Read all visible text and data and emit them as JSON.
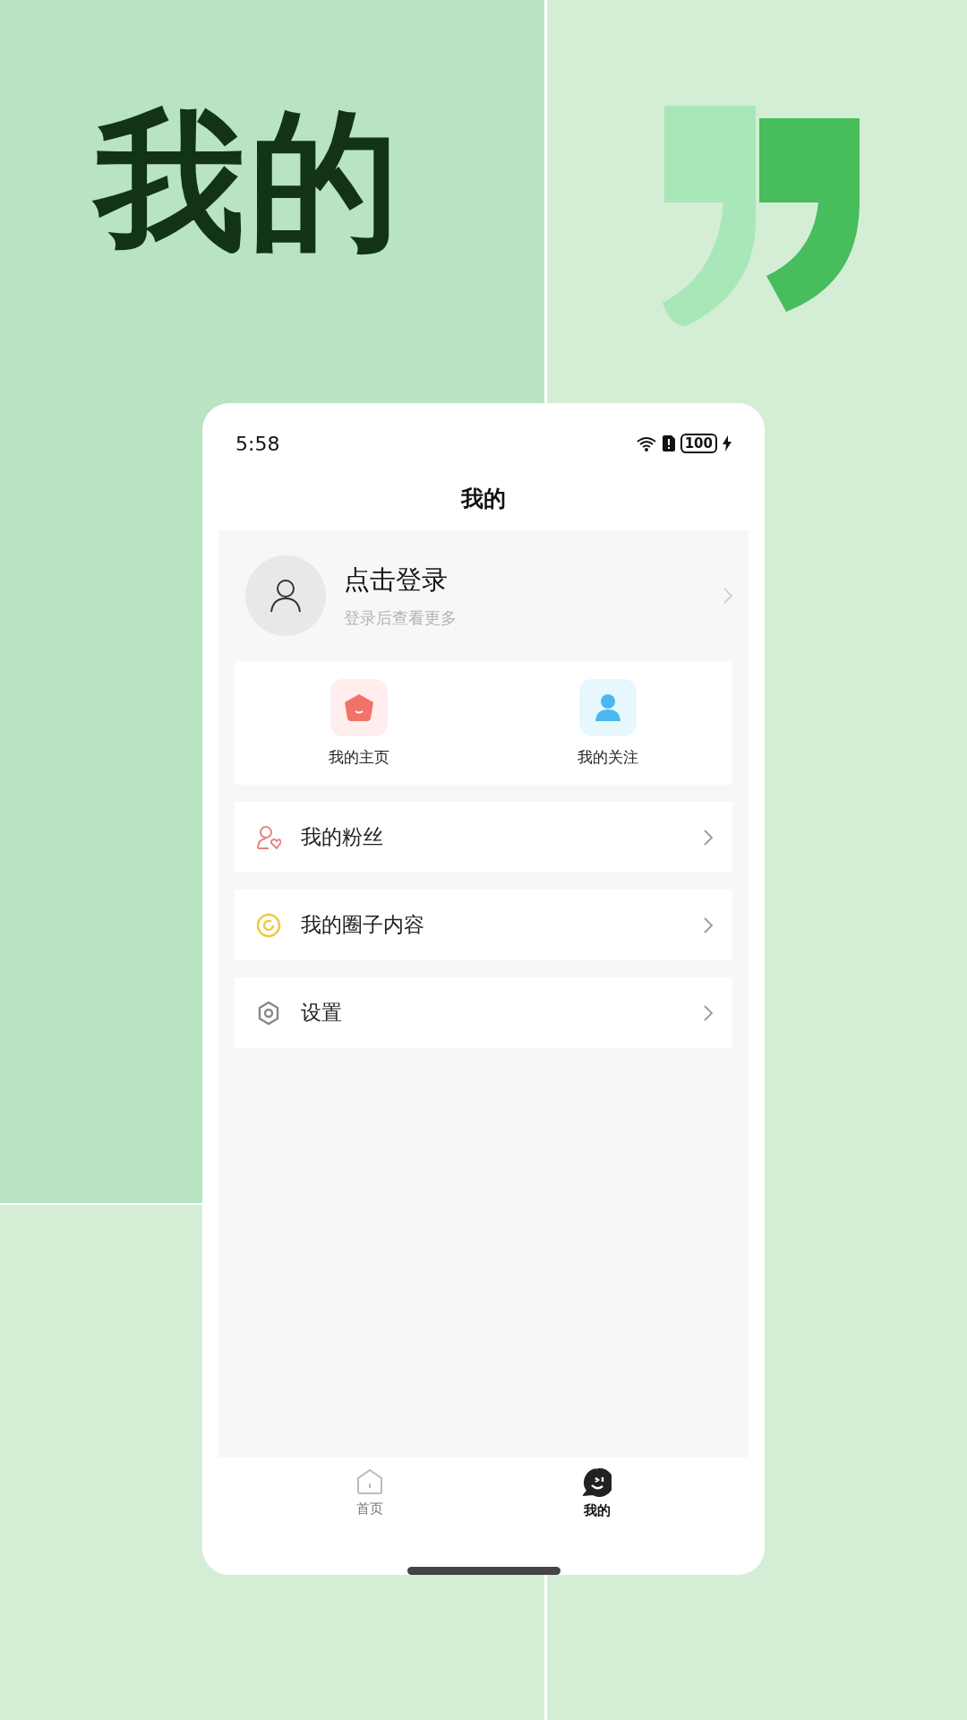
{
  "headline": "我的",
  "status_bar": {
    "time": "5:58",
    "battery": "100"
  },
  "header": {
    "title": "我的"
  },
  "profile": {
    "name": "点击登录",
    "hint": "登录后查看更多"
  },
  "shortcuts": [
    {
      "kind": "home",
      "label": "我的主页"
    },
    {
      "kind": "follow",
      "label": "我的关注"
    }
  ],
  "menu": [
    {
      "kind": "fans",
      "label": "我的粉丝"
    },
    {
      "kind": "circle",
      "label": "我的圈子内容"
    },
    {
      "kind": "settings",
      "label": "设置"
    }
  ],
  "tab_bar": [
    {
      "kind": "home",
      "label": "首页",
      "selected": false
    },
    {
      "kind": "me",
      "label": "我的",
      "selected": true
    }
  ]
}
